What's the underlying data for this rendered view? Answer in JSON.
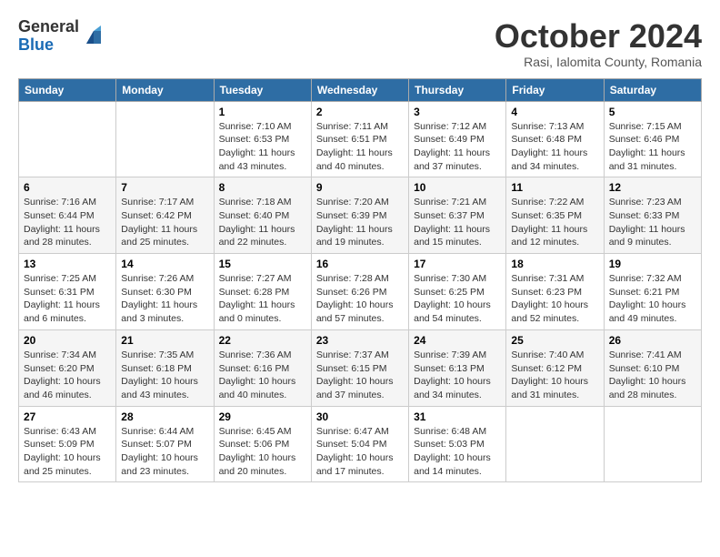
{
  "logo": {
    "general": "General",
    "blue": "Blue"
  },
  "title": "October 2024",
  "subtitle": "Rasi, Ialomita County, Romania",
  "weekdays": [
    "Sunday",
    "Monday",
    "Tuesday",
    "Wednesday",
    "Thursday",
    "Friday",
    "Saturday"
  ],
  "weeks": [
    [
      {
        "day": "",
        "info": ""
      },
      {
        "day": "",
        "info": ""
      },
      {
        "day": "1",
        "info": "Sunrise: 7:10 AM\nSunset: 6:53 PM\nDaylight: 11 hours and 43 minutes."
      },
      {
        "day": "2",
        "info": "Sunrise: 7:11 AM\nSunset: 6:51 PM\nDaylight: 11 hours and 40 minutes."
      },
      {
        "day": "3",
        "info": "Sunrise: 7:12 AM\nSunset: 6:49 PM\nDaylight: 11 hours and 37 minutes."
      },
      {
        "day": "4",
        "info": "Sunrise: 7:13 AM\nSunset: 6:48 PM\nDaylight: 11 hours and 34 minutes."
      },
      {
        "day": "5",
        "info": "Sunrise: 7:15 AM\nSunset: 6:46 PM\nDaylight: 11 hours and 31 minutes."
      }
    ],
    [
      {
        "day": "6",
        "info": "Sunrise: 7:16 AM\nSunset: 6:44 PM\nDaylight: 11 hours and 28 minutes."
      },
      {
        "day": "7",
        "info": "Sunrise: 7:17 AM\nSunset: 6:42 PM\nDaylight: 11 hours and 25 minutes."
      },
      {
        "day": "8",
        "info": "Sunrise: 7:18 AM\nSunset: 6:40 PM\nDaylight: 11 hours and 22 minutes."
      },
      {
        "day": "9",
        "info": "Sunrise: 7:20 AM\nSunset: 6:39 PM\nDaylight: 11 hours and 19 minutes."
      },
      {
        "day": "10",
        "info": "Sunrise: 7:21 AM\nSunset: 6:37 PM\nDaylight: 11 hours and 15 minutes."
      },
      {
        "day": "11",
        "info": "Sunrise: 7:22 AM\nSunset: 6:35 PM\nDaylight: 11 hours and 12 minutes."
      },
      {
        "day": "12",
        "info": "Sunrise: 7:23 AM\nSunset: 6:33 PM\nDaylight: 11 hours and 9 minutes."
      }
    ],
    [
      {
        "day": "13",
        "info": "Sunrise: 7:25 AM\nSunset: 6:31 PM\nDaylight: 11 hours and 6 minutes."
      },
      {
        "day": "14",
        "info": "Sunrise: 7:26 AM\nSunset: 6:30 PM\nDaylight: 11 hours and 3 minutes."
      },
      {
        "day": "15",
        "info": "Sunrise: 7:27 AM\nSunset: 6:28 PM\nDaylight: 11 hours and 0 minutes."
      },
      {
        "day": "16",
        "info": "Sunrise: 7:28 AM\nSunset: 6:26 PM\nDaylight: 10 hours and 57 minutes."
      },
      {
        "day": "17",
        "info": "Sunrise: 7:30 AM\nSunset: 6:25 PM\nDaylight: 10 hours and 54 minutes."
      },
      {
        "day": "18",
        "info": "Sunrise: 7:31 AM\nSunset: 6:23 PM\nDaylight: 10 hours and 52 minutes."
      },
      {
        "day": "19",
        "info": "Sunrise: 7:32 AM\nSunset: 6:21 PM\nDaylight: 10 hours and 49 minutes."
      }
    ],
    [
      {
        "day": "20",
        "info": "Sunrise: 7:34 AM\nSunset: 6:20 PM\nDaylight: 10 hours and 46 minutes."
      },
      {
        "day": "21",
        "info": "Sunrise: 7:35 AM\nSunset: 6:18 PM\nDaylight: 10 hours and 43 minutes."
      },
      {
        "day": "22",
        "info": "Sunrise: 7:36 AM\nSunset: 6:16 PM\nDaylight: 10 hours and 40 minutes."
      },
      {
        "day": "23",
        "info": "Sunrise: 7:37 AM\nSunset: 6:15 PM\nDaylight: 10 hours and 37 minutes."
      },
      {
        "day": "24",
        "info": "Sunrise: 7:39 AM\nSunset: 6:13 PM\nDaylight: 10 hours and 34 minutes."
      },
      {
        "day": "25",
        "info": "Sunrise: 7:40 AM\nSunset: 6:12 PM\nDaylight: 10 hours and 31 minutes."
      },
      {
        "day": "26",
        "info": "Sunrise: 7:41 AM\nSunset: 6:10 PM\nDaylight: 10 hours and 28 minutes."
      }
    ],
    [
      {
        "day": "27",
        "info": "Sunrise: 6:43 AM\nSunset: 5:09 PM\nDaylight: 10 hours and 25 minutes."
      },
      {
        "day": "28",
        "info": "Sunrise: 6:44 AM\nSunset: 5:07 PM\nDaylight: 10 hours and 23 minutes."
      },
      {
        "day": "29",
        "info": "Sunrise: 6:45 AM\nSunset: 5:06 PM\nDaylight: 10 hours and 20 minutes."
      },
      {
        "day": "30",
        "info": "Sunrise: 6:47 AM\nSunset: 5:04 PM\nDaylight: 10 hours and 17 minutes."
      },
      {
        "day": "31",
        "info": "Sunrise: 6:48 AM\nSunset: 5:03 PM\nDaylight: 10 hours and 14 minutes."
      },
      {
        "day": "",
        "info": ""
      },
      {
        "day": "",
        "info": ""
      }
    ]
  ]
}
